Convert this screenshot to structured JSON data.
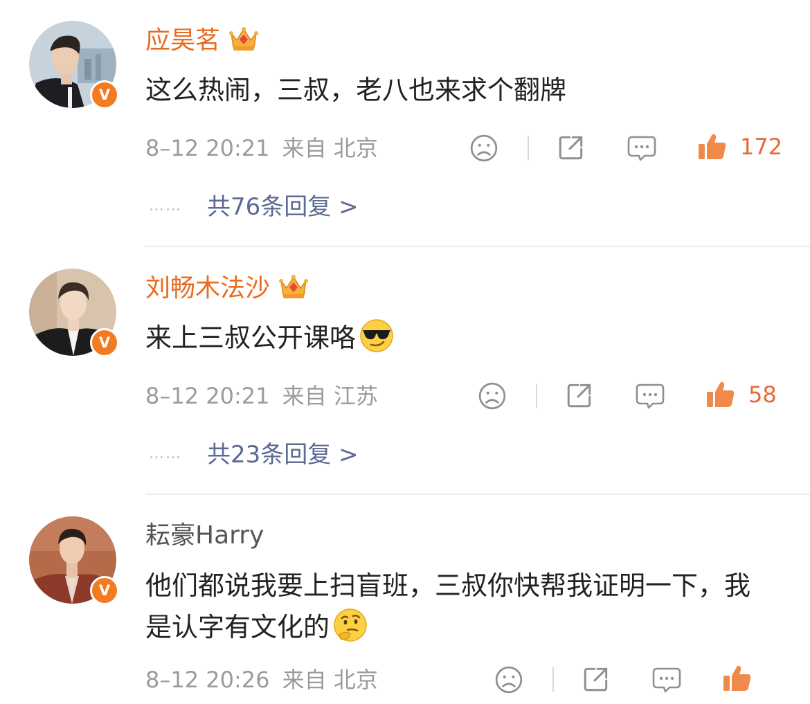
{
  "colors": {
    "vip_name": "#e86b1f",
    "plain_name": "#555555",
    "meta": "#9b9b9b",
    "reply_link": "#5b6a92",
    "like": "#e56a32",
    "verified_badge": "#f47a20"
  },
  "comments": [
    {
      "username": "应昊茗",
      "vip": true,
      "badge": "V",
      "text": "这么热闹，三叔，老八也来求个翻牌",
      "emoji": "",
      "date": "8–12 20:21",
      "location": "来自 北京",
      "likes": "172",
      "replies_dots": "……",
      "replies": "共76条回复 >"
    },
    {
      "username": "刘畅木法沙",
      "vip": true,
      "badge": "V",
      "text": "来上三叔公开课咯",
      "emoji": "sunglasses-emoji",
      "date": "8–12 20:21",
      "location": "来自 江苏",
      "likes": "58",
      "replies_dots": "……",
      "replies": "共23条回复 >"
    },
    {
      "username": "耘豪Harry",
      "vip": false,
      "badge": "V",
      "text": "他们都说我要上扫盲班，三叔你快帮我证明一下，我是认字有文化的",
      "emoji": "thinking-emoji",
      "date": "8–12 20:26",
      "location": "来自 北京",
      "likes": "",
      "replies_dots": "",
      "replies": ""
    }
  ],
  "icons": [
    "sad-face-icon",
    "share-icon",
    "comment-icon",
    "thumbs-up-icon",
    "crown-icon"
  ]
}
